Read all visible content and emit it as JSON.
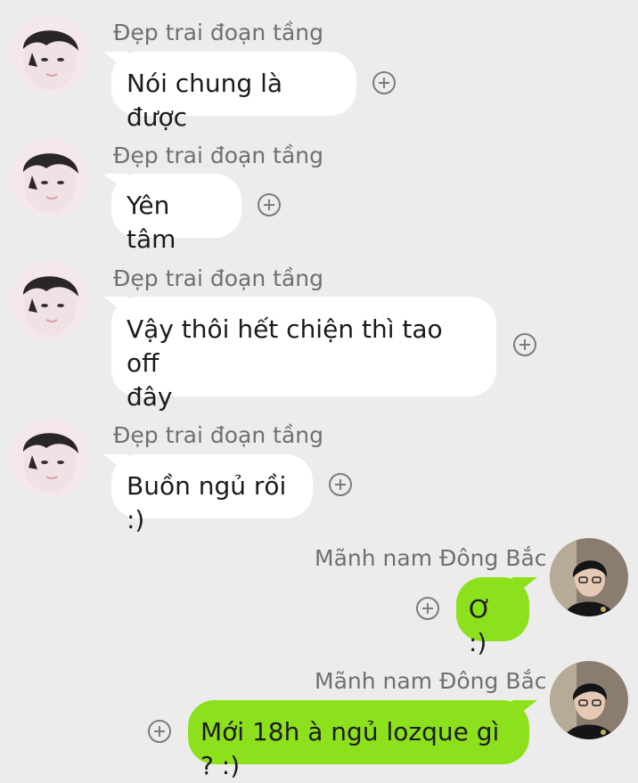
{
  "conversation": {
    "incoming_sender": "Đẹp trai đoạn tầng",
    "outgoing_sender": "Mãnh nam Đông Bắc",
    "messages": [
      {
        "direction": "incoming",
        "sender": "Đẹp trai đoạn tầng",
        "text": "Nói chung là được"
      },
      {
        "direction": "incoming",
        "sender": "Đẹp trai đoạn tầng",
        "text": "Yên tâm"
      },
      {
        "direction": "incoming",
        "sender": "Đẹp trai đoạn tầng",
        "text": "Vậy thôi hết chiện thì tao off\nđây"
      },
      {
        "direction": "incoming",
        "sender": "Đẹp trai đoạn tầng",
        "text": "Buồn ngủ rồi :)"
      },
      {
        "direction": "outgoing",
        "sender": "Mãnh nam Đông Bắc",
        "text": "Ơ :)"
      },
      {
        "direction": "outgoing",
        "sender": "Mãnh nam Đông Bắc",
        "text": "Mới 18h à ngủ lozque gì ? :)"
      }
    ]
  },
  "icons": {
    "reaction": "add-reaction-icon",
    "incoming_avatar": "avatar-incoming",
    "outgoing_avatar": "avatar-outgoing"
  },
  "colors": {
    "background": "#ececec",
    "incoming_bubble": "#ffffff",
    "outgoing_bubble": "#8de01c",
    "sender_name": "#707070",
    "icon": "#7c7c7c"
  }
}
